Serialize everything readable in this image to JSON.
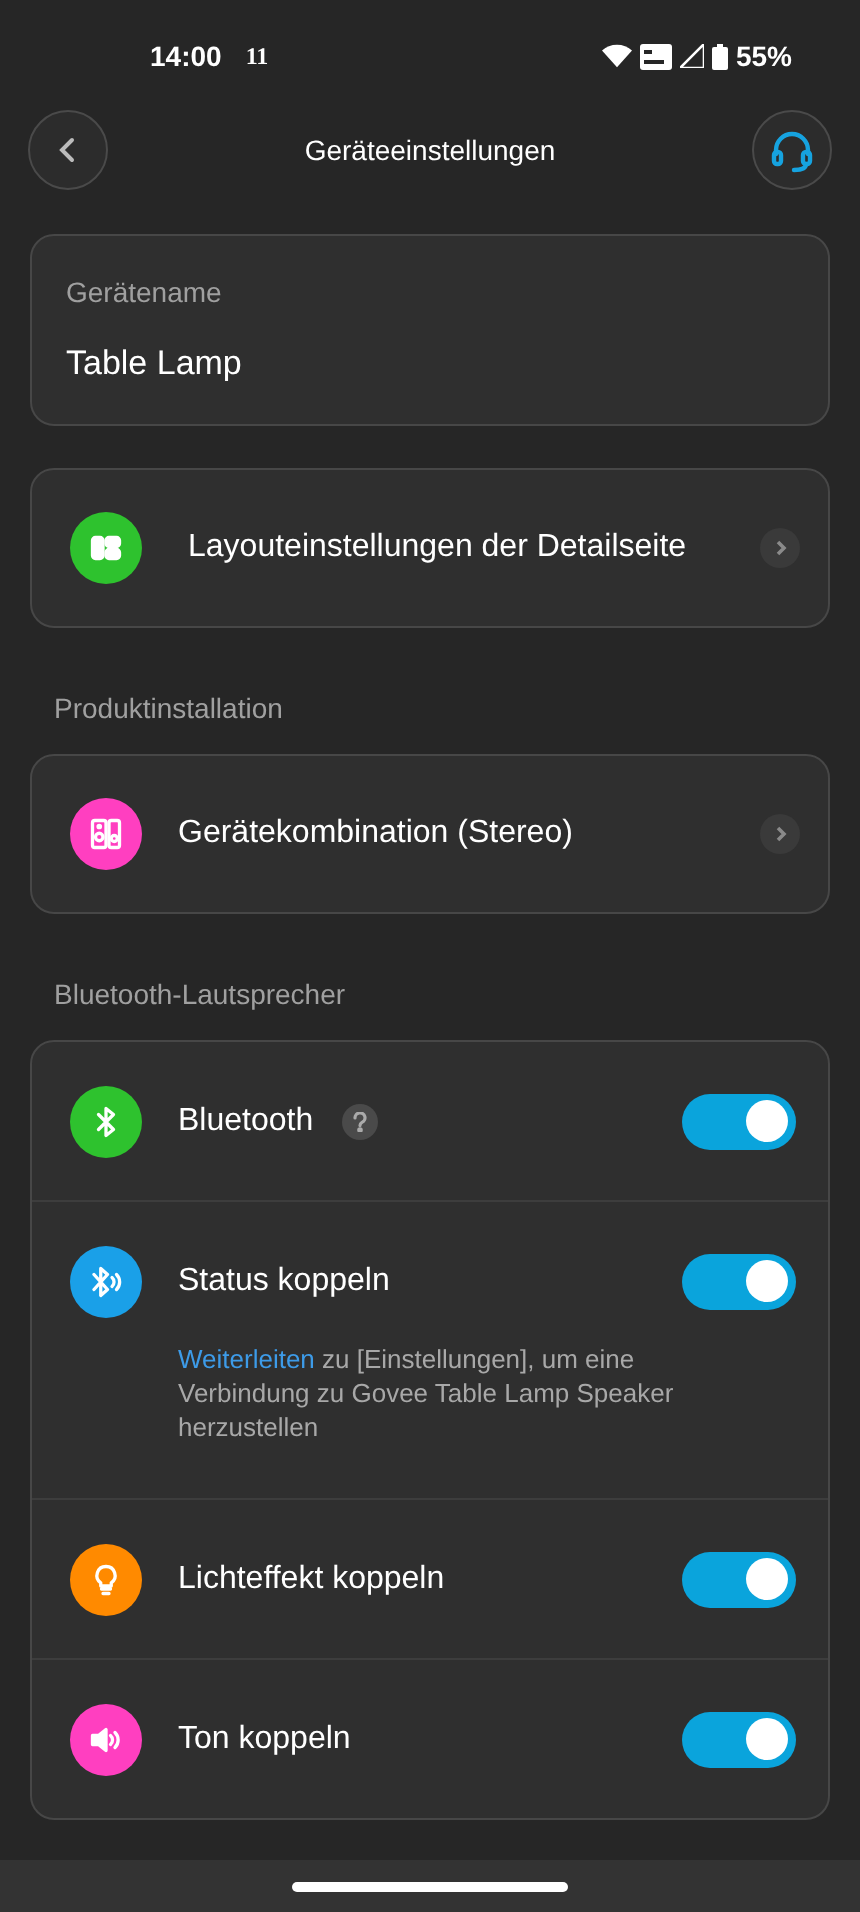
{
  "status_bar": {
    "time": "14:00",
    "notification": "11",
    "battery": "55%"
  },
  "header": {
    "title": "Geräteeinstellungen"
  },
  "device_name": {
    "label": "Gerätename",
    "value": "Table Lamp"
  },
  "layout_item": {
    "label": "Layouteinstellungen der Detailseite",
    "color": "#2ec22e"
  },
  "sections": [
    {
      "title": "Produktinstallation",
      "items": [
        {
          "kind": "link",
          "label": "Gerätekombination (Stereo)",
          "color": "#ff3fc0"
        }
      ]
    },
    {
      "title": "Bluetooth-Lautsprecher",
      "items": [
        {
          "kind": "toggle",
          "label": "Bluetooth",
          "color": "#2ec22e",
          "help": true,
          "on": true
        },
        {
          "kind": "toggle",
          "label": "Status koppeln",
          "color": "#1aa0e8",
          "help": false,
          "on": true,
          "note": {
            "link": "Weiterleiten",
            "text": "zu [Einstellungen], um eine Verbindung zu Govee Table Lamp Speaker herzustellen"
          }
        },
        {
          "kind": "toggle",
          "label": "Lichteffekt koppeln",
          "color": "#ff8a00",
          "help": false,
          "on": true
        },
        {
          "kind": "toggle",
          "label": "Ton koppeln",
          "color": "#ff3fc0",
          "help": false,
          "on": true
        }
      ]
    }
  ]
}
